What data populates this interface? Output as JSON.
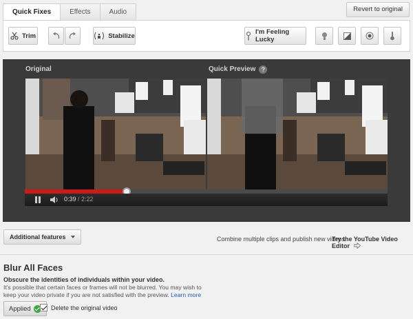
{
  "tabs": [
    {
      "label": "Quick Fixes",
      "active": true
    },
    {
      "label": "Effects",
      "active": false
    },
    {
      "label": "Audio",
      "active": false
    }
  ],
  "revert_label": "Revert to original",
  "toolbar": {
    "trim_label": "Trim",
    "stabilize_label": "Stabilize",
    "lucky_label": "I'm Feeling Lucky",
    "icons": [
      "scissors-icon",
      "rotate-left-icon",
      "rotate-right-icon",
      "stabilize-icon",
      "magic-wand-icon",
      "lightbulb-icon",
      "contrast-icon",
      "saturation-icon",
      "temperature-icon"
    ]
  },
  "video": {
    "original_label": "Original",
    "preview_label": "Quick Preview",
    "current_time": "0:39",
    "duration": "/ 2:22",
    "progress_fraction": 0.28
  },
  "promo": {
    "additional_label": "Additional features",
    "combine_text": "Combine multiple clips and publish new videos.",
    "try_link": "Try the YouTube Video Editor"
  },
  "blur": {
    "title": "Blur All Faces",
    "subtitle": "Obscure the identities of individuals within your video.",
    "description": "It's possible that certain faces or frames will not be blurred. You may wish to keep your video private if you are not satisfied with the preview.",
    "learn_more": "Learn more",
    "applied_label": "Applied",
    "delete_label": "Delete the original video",
    "delete_checked": true
  },
  "colors": {
    "accent_red": "#cc1a1a",
    "applied_green": "#3ea53e",
    "link_blue": "#1a5bb8"
  }
}
